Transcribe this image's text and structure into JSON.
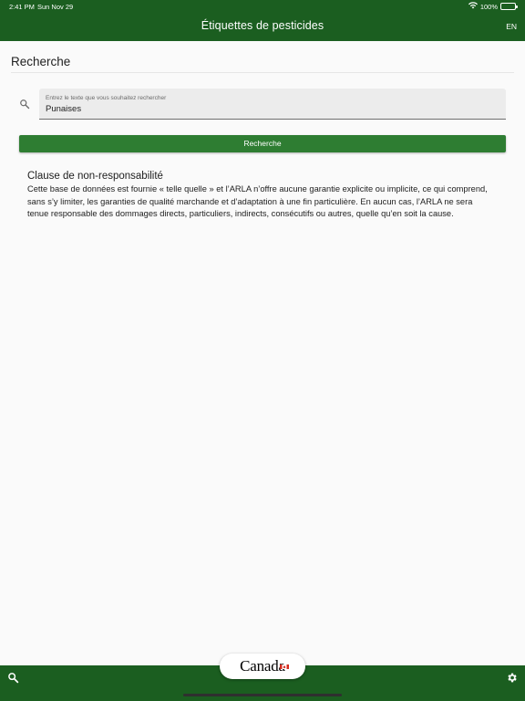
{
  "status_bar": {
    "time": "2:41 PM",
    "date": "Sun Nov 29",
    "battery": "100%"
  },
  "app_bar": {
    "title": "Étiquettes de pesticides",
    "language_toggle": "EN"
  },
  "search_section": {
    "title": "Recherche",
    "field_label": "Entrez le texte que vous souhaitez rechercher",
    "field_value": "Punaises",
    "button_label": "Recherche"
  },
  "disclaimer": {
    "title": "Clause de non-responsabilité",
    "body": "Cette base de données est fournie « telle quelle » et l’ARLA n’offre aucune garantie explicite ou implicite, ce qui comprend, sans s’y limiter, les garanties de qualité marchande et d’adaptation à une fin particulière. En aucun cas, l’ARLA ne sera tenue responsable des dommages directs, particuliers, indirects, consécutifs ou autres, quelle qu’en soit la cause."
  },
  "footer": {
    "wordmark": "Canada"
  },
  "colors": {
    "primary_dark": "#1b5e20",
    "primary": "#2e7d32",
    "background": "#fafafa",
    "field_background": "#ececec"
  },
  "icons": {
    "search": "search-icon",
    "settings": "gear-icon",
    "wifi": "wifi-icon",
    "battery": "battery-icon"
  }
}
